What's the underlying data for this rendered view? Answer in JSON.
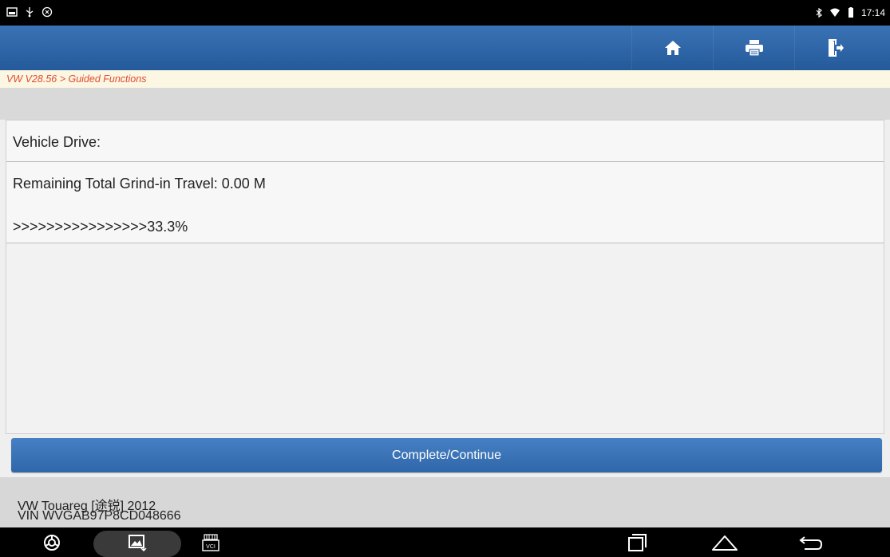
{
  "statusbar": {
    "time": "17:14",
    "left_icons": [
      "gallery-icon",
      "usb-icon",
      "vpn-icon"
    ],
    "right_icons": [
      "bluetooth-icon",
      "wifi-icon",
      "battery-icon"
    ]
  },
  "toolbar": {
    "buttons": [
      "home-icon",
      "print-icon",
      "exit-icon"
    ]
  },
  "breadcrumb": "VW V28.56 > Guided Functions",
  "content": {
    "rows": [
      {
        "label": "Vehicle Drive:"
      },
      {
        "label": "Remaining Total Grind-in Travel: 0.00 M",
        "progress_text": ">>>>>>>>>>>>>>>>33.3%"
      }
    ]
  },
  "action": {
    "continue_label": "Complete/Continue"
  },
  "footer": {
    "vehicle": "VW Touareg [途锐] 2012",
    "vin": "VIN WVGAB97P8CD048666"
  },
  "navbar": {
    "items": [
      "browser-icon",
      "screenshot-icon",
      "vci-icon",
      "recent-apps-icon",
      "home-nav-icon",
      "back-icon"
    ],
    "vci_label": "VCI"
  },
  "colors": {
    "toolbar": "#2f67a9",
    "breadcrumb_text": "#e14a2e",
    "breadcrumb_bg": "#fcf7e3",
    "button": "#3a73b5"
  }
}
